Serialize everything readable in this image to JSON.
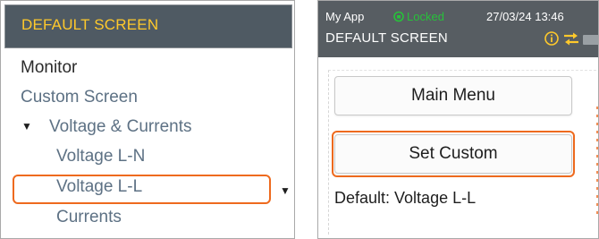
{
  "left_panel": {
    "header_title": "DEFAULT SCREEN",
    "tree": {
      "monitor": "Monitor",
      "custom_screen": "Custom Screen",
      "voltage_currents": "Voltage & Currents",
      "voltage_ln": "Voltage L-N",
      "voltage_ll": "Voltage L-L",
      "currents": "Currents"
    },
    "expanded_glyph": "▼",
    "dropdown_glyph": "▼"
  },
  "right_panel": {
    "status_bar": {
      "app_name": "My App",
      "lock_status": "Locked",
      "datetime": "27/03/24 13:46",
      "screen_title": "DEFAULT SCREEN",
      "icons": [
        "lock-icon",
        "info-icon",
        "swap-arrows-icon",
        "battery-icon"
      ]
    },
    "main_menu_button": "Main Menu",
    "set_custom_button": "Set Custom",
    "default_label": "Default: Voltage L-L"
  },
  "colors": {
    "header_bg": "#4f5a63",
    "header_text": "#ffc92b",
    "status_bar_bg": "#575d62",
    "locked_green": "#27c13a",
    "highlight_orange": "#ee6a1e",
    "tree_text": "#5d7184"
  }
}
